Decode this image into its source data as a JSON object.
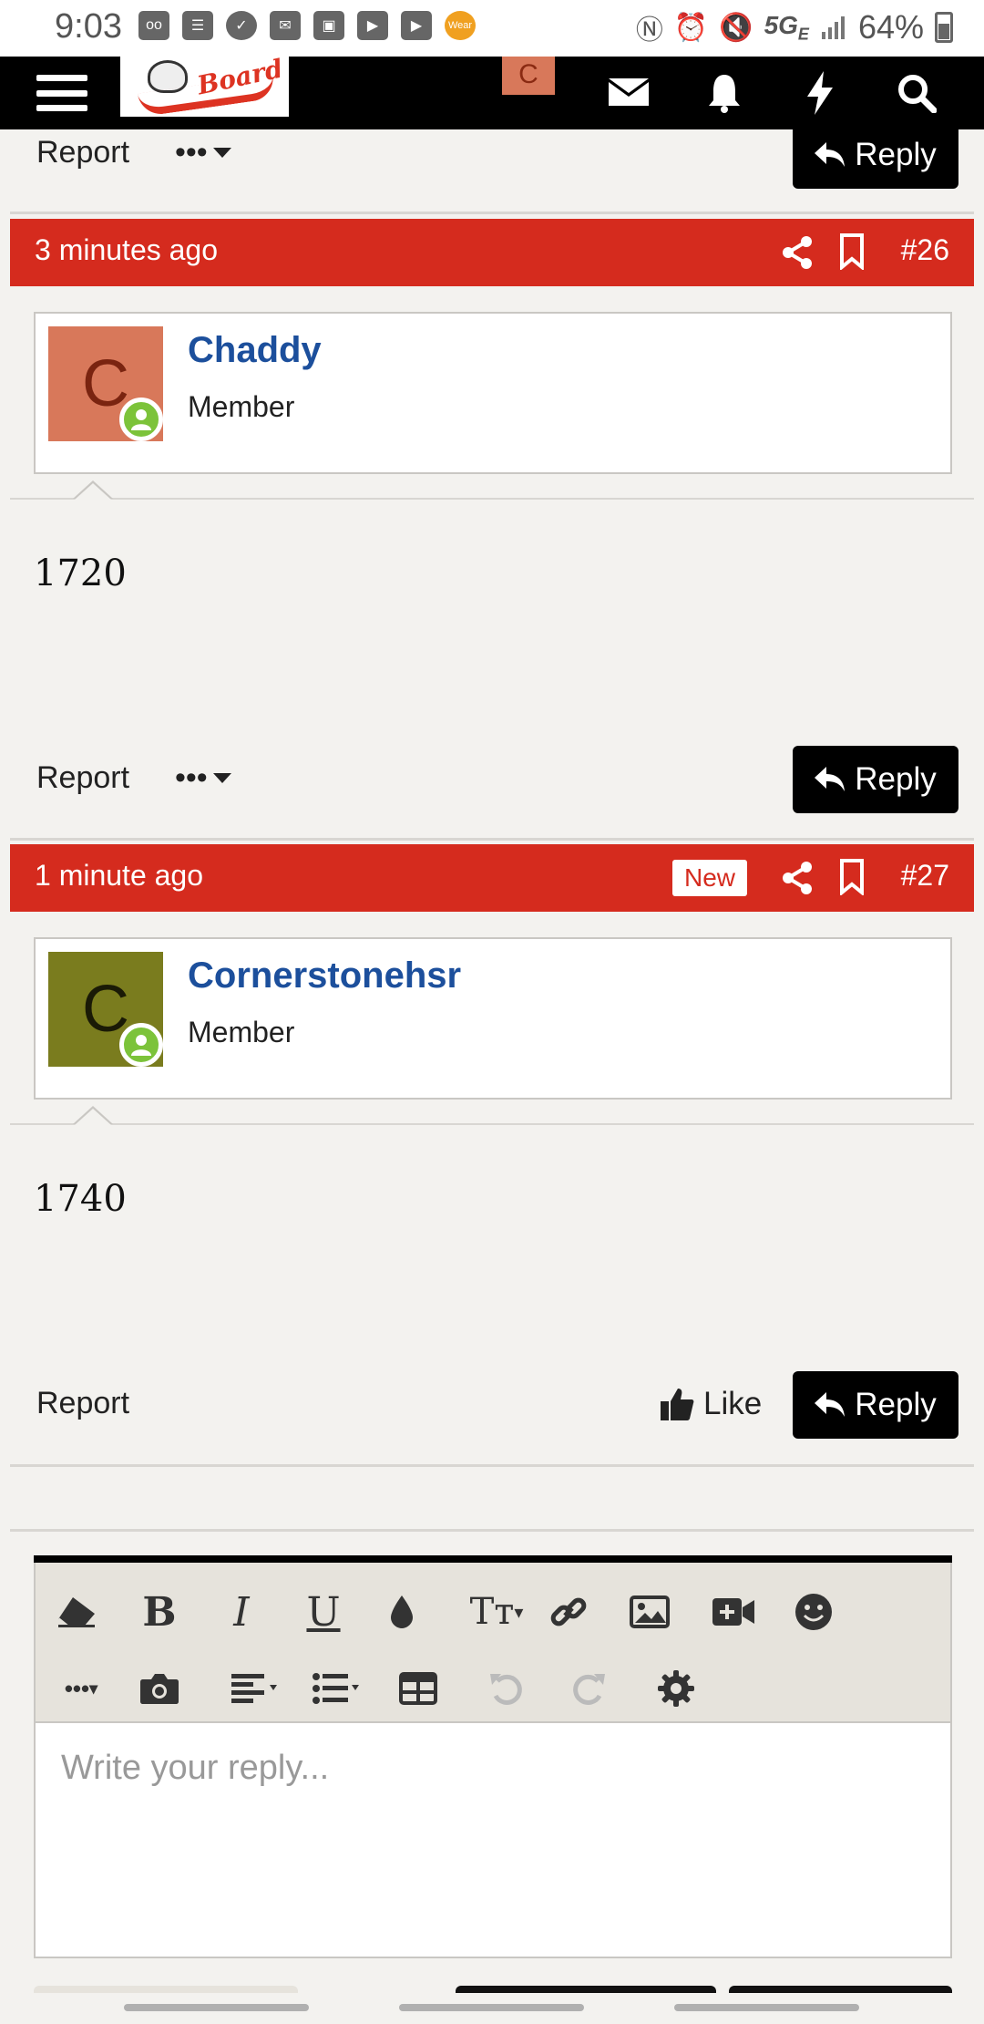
{
  "status_bar": {
    "time": "9:03",
    "network": "5G",
    "network_suffix": "E",
    "battery": "64%",
    "wear_label": "Wear"
  },
  "header": {
    "avatar_letter": "C",
    "logo_text": "Board"
  },
  "prev_post_footer": {
    "report": "Report",
    "more": "•••",
    "reply": "Reply"
  },
  "posts": [
    {
      "time": "3 minutes ago",
      "number": "#26",
      "username": "Chaddy",
      "role": "Member",
      "avatar_letter": "C",
      "avatar_bg": "#d8785a",
      "avatar_fg": "#7a2410",
      "body": "1720",
      "report": "Report",
      "more": "•••",
      "reply": "Reply"
    },
    {
      "time": "1 minute ago",
      "badge": "New",
      "number": "#27",
      "username": "Cornerstonehsr",
      "role": "Member",
      "avatar_letter": "C",
      "avatar_bg": "#7a7c1e",
      "avatar_fg": "#1a1a06",
      "body": "1740",
      "report": "Report",
      "like": "Like",
      "reply": "Reply"
    }
  ],
  "editor": {
    "placeholder": "Write your reply...",
    "toolbar_row1": [
      "eraser-icon",
      "bold-icon",
      "italic-icon",
      "underline-icon",
      "text-color-icon",
      "font-size-icon",
      "link-icon",
      "image-icon",
      "video-icon",
      "smiley-icon"
    ],
    "toolbar_row2": [
      "more-options-icon",
      "camera-icon",
      "align-icon",
      "list-icon",
      "table-icon",
      "undo-icon",
      "redo-icon",
      "settings-icon"
    ]
  },
  "colors": {
    "accent_red": "#d52b1e",
    "username_blue": "#1c4f9c",
    "online_green": "#7cc33a",
    "page_bg": "#f3f2ef"
  }
}
